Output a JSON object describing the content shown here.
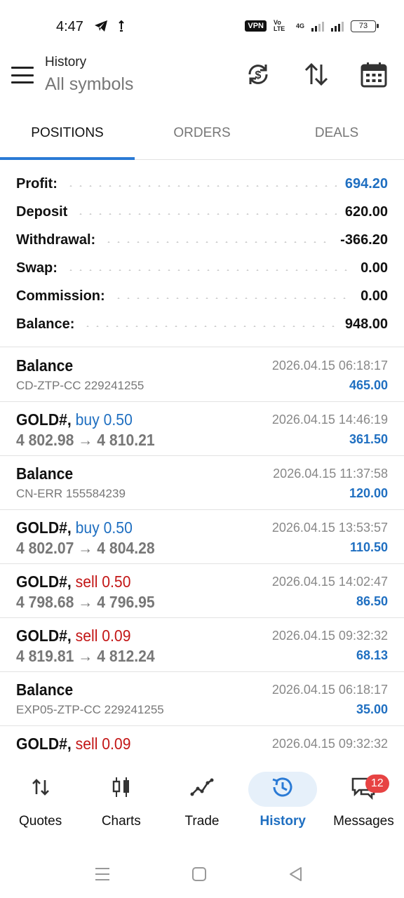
{
  "status_bar": {
    "time": "4:47",
    "vpn": "VPN",
    "volte": "Vo LTE",
    "net": "4G",
    "battery": "73"
  },
  "header": {
    "title": "History",
    "subtitle": "All symbols"
  },
  "tabs": [
    {
      "label": "POSITIONS",
      "active": true
    },
    {
      "label": "ORDERS",
      "active": false
    },
    {
      "label": "DEALS",
      "active": false
    }
  ],
  "summary": [
    {
      "label": "Profit:",
      "value": "694.20",
      "highlight": true
    },
    {
      "label": "Deposit",
      "value": "620.00"
    },
    {
      "label": "Withdrawal:",
      "value": "-366.20"
    },
    {
      "label": "Swap:",
      "value": "0.00"
    },
    {
      "label": "Commission:",
      "value": "0.00"
    },
    {
      "label": "Balance:",
      "value": "948.00"
    }
  ],
  "deals": [
    {
      "title": "Balance",
      "sub": "CD-ZTP-CC 229241255",
      "time": "2026.04.15 06:18:17",
      "profit": "465.00"
    },
    {
      "symbol": "GOLD#,",
      "side": "buy 0.50",
      "side_type": "buy",
      "open": "4 802.98",
      "arrow": "→",
      "close": "4 810.21",
      "time": "2026.04.15 14:46:19",
      "profit": "361.50"
    },
    {
      "title": "Balance",
      "sub": "CN-ERR 155584239",
      "time": "2026.04.15 11:37:58",
      "profit": "120.00"
    },
    {
      "symbol": "GOLD#,",
      "side": "buy 0.50",
      "side_type": "buy",
      "open": "4 802.07",
      "arrow": "→",
      "close": "4 804.28",
      "time": "2026.04.15 13:53:57",
      "profit": "110.50"
    },
    {
      "symbol": "GOLD#,",
      "side": "sell 0.50",
      "side_type": "sell",
      "open": "4 798.68",
      "arrow": "→",
      "close": "4 796.95",
      "time": "2026.04.15 14:02:47",
      "profit": "86.50"
    },
    {
      "symbol": "GOLD#,",
      "side": "sell 0.09",
      "side_type": "sell",
      "open": "4 819.81",
      "arrow": "→",
      "close": "4 812.24",
      "time": "2026.04.15 09:32:32",
      "profit": "68.13"
    },
    {
      "title": "Balance",
      "sub": "EXP05-ZTP-CC 229241255",
      "time": "2026.04.15 06:18:17",
      "profit": "35.00"
    },
    {
      "symbol": "GOLD#,",
      "side": "sell 0.09",
      "side_type": "sell",
      "time": "2026.04.15 09:32:32"
    }
  ],
  "bottom_nav": [
    {
      "label": "Quotes",
      "icon": "quotes-arrows-icon"
    },
    {
      "label": "Charts",
      "icon": "candlestick-icon"
    },
    {
      "label": "Trade",
      "icon": "trade-line-icon"
    },
    {
      "label": "History",
      "icon": "history-clock-icon",
      "active": true
    },
    {
      "label": "Messages",
      "icon": "messages-icon",
      "badge": "12"
    }
  ],
  "colors": {
    "accent": "#2a7ad5",
    "profit_blue": "#1f6fc1",
    "sell_red": "#c31616",
    "badge_red": "#e74343"
  }
}
